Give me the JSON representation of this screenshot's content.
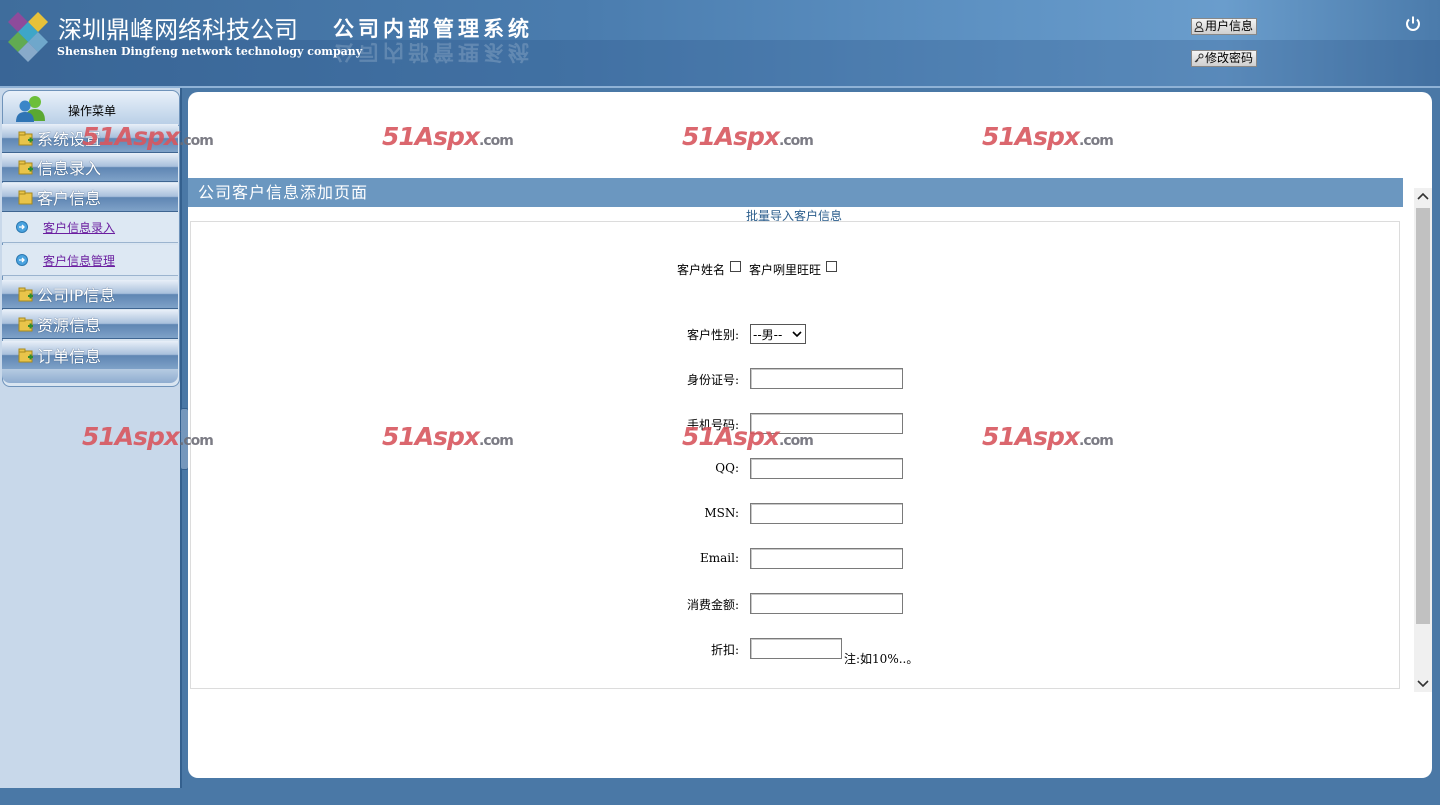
{
  "header": {
    "company_cn": "深圳鼎峰网络科技公司",
    "company_en": "Shenshen Dingfeng network technology company",
    "system_title": "公司内部管理系统",
    "user_info_button": "用户信息",
    "change_password_button": "修改密码"
  },
  "sidebar": {
    "menu_title": "操作菜单",
    "categories": [
      {
        "label": "系统设置"
      },
      {
        "label": "信息录入"
      },
      {
        "label": "客户信息"
      },
      {
        "label": "公司IP信息"
      },
      {
        "label": "资源信息"
      },
      {
        "label": "订单信息"
      }
    ],
    "sub_items": [
      {
        "label": "客户信息录入"
      },
      {
        "label": "客户信息管理"
      }
    ]
  },
  "main": {
    "page_title": "公司客户信息添加页面",
    "import_link": "批量导入客户信息",
    "form": {
      "name_checkbox_label": "客户姓名",
      "wangwang_checkbox_label": "客户咧里旺旺",
      "gender_label": "客户性别:",
      "gender_value": "--男--",
      "id_label": "身份证号:",
      "phone_label": "手机号码:",
      "qq_label": "QQ:",
      "msn_label": "MSN:",
      "email_label": "Email:",
      "amount_label": "消费金额:",
      "discount_label": "折扣:",
      "discount_note": "注:如10%..。"
    }
  },
  "watermark": {
    "brand_num": "51",
    "brand_name": "Aspx",
    "brand_suffix": ".com"
  },
  "colors": {
    "header_blue": "#4a7cae",
    "title_bar": "#6b97c0",
    "sub_link": "#6b1fa0",
    "watermark_red": "#d8575f"
  }
}
